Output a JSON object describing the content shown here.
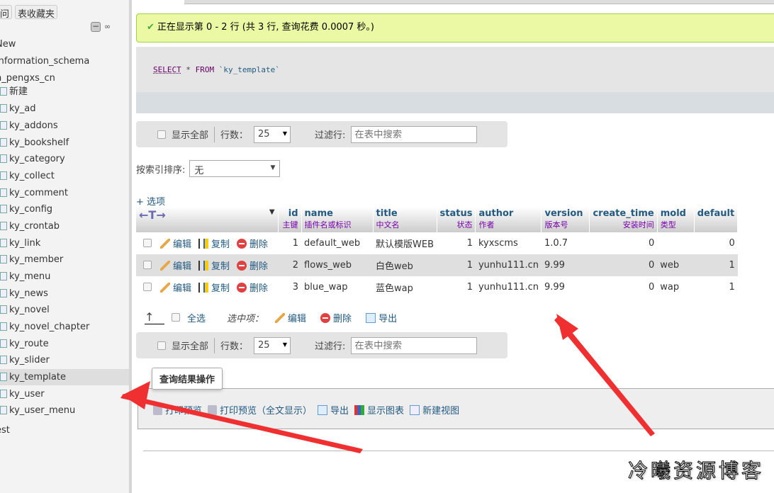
{
  "sidebar": {
    "buttons": [
      "问",
      "表收藏夹"
    ],
    "items": [
      {
        "label": "New"
      },
      {
        "label": "information_schema"
      },
      {
        "label": "n_pengxs_cn"
      },
      {
        "label": "新建"
      },
      {
        "label": "ky_ad"
      },
      {
        "label": "ky_addons"
      },
      {
        "label": "ky_bookshelf"
      },
      {
        "label": "ky_category"
      },
      {
        "label": "ky_collect"
      },
      {
        "label": "ky_comment"
      },
      {
        "label": "ky_config"
      },
      {
        "label": "ky_crontab"
      },
      {
        "label": "ky_link"
      },
      {
        "label": "ky_member"
      },
      {
        "label": "ky_menu"
      },
      {
        "label": "ky_news"
      },
      {
        "label": "ky_novel"
      },
      {
        "label": "ky_novel_chapter"
      },
      {
        "label": "ky_route"
      },
      {
        "label": "ky_slider"
      },
      {
        "label": "ky_template",
        "selected": true
      },
      {
        "label": "ky_user"
      },
      {
        "label": "ky_user_menu"
      },
      {
        "label": "est"
      }
    ]
  },
  "message": "正在显示第 0 - 2 行 (共 3 行, 查询花费 0.0007 秒。)",
  "sql": {
    "select": "SELECT",
    "star": " * ",
    "from": "FROM",
    "table": " `ky_template`"
  },
  "nav": {
    "show_all": "显示全部",
    "rows_label": "行数：",
    "rows_value": "25",
    "filter_label": "过滤行:",
    "filter_placeholder": "在表中搜索"
  },
  "sort": {
    "label": "按索引排序:",
    "value": "无"
  },
  "options_link": "+ 选项",
  "table": {
    "columns": [
      {
        "name": "id",
        "comment": "主键"
      },
      {
        "name": "name",
        "comment": "插件名或标识"
      },
      {
        "name": "title",
        "comment": "中文名"
      },
      {
        "name": "status",
        "comment": "状态"
      },
      {
        "name": "author",
        "comment": "作者"
      },
      {
        "name": "version",
        "comment": "版本号"
      },
      {
        "name": "create_time",
        "comment": "安装时间"
      },
      {
        "name": "mold",
        "comment": "类型"
      },
      {
        "name": "default",
        "comment": ""
      }
    ],
    "actions": {
      "edit": "编辑",
      "copy": "复制",
      "delete": "删除"
    },
    "rows": [
      [
        "1",
        "default_web",
        "默认模版WEB",
        "1",
        "kyxscms",
        "1.0.7",
        "0",
        "",
        "0"
      ],
      [
        "2",
        "flows_web",
        "白色web",
        "1",
        "yunhu111.cn",
        "9.99",
        "0",
        "web",
        "1"
      ],
      [
        "3",
        "blue_wap",
        "蓝色wap",
        "1",
        "yunhu111.cn",
        "9.99",
        "0",
        "wap",
        "1"
      ]
    ]
  },
  "bulk": {
    "select_all": "全选",
    "with_selected": "选中项：",
    "edit": "编辑",
    "delete": "删除",
    "export": "导出"
  },
  "ops": {
    "title": "查询结果操作",
    "items": [
      "打印预览",
      "打印预览（全文显示）",
      "导出",
      "显示图表",
      "新建视图"
    ]
  },
  "watermark": "冷曦资源博客",
  "colors": {
    "success_bg": "#ebf8a4",
    "arrow": "#f03030"
  }
}
